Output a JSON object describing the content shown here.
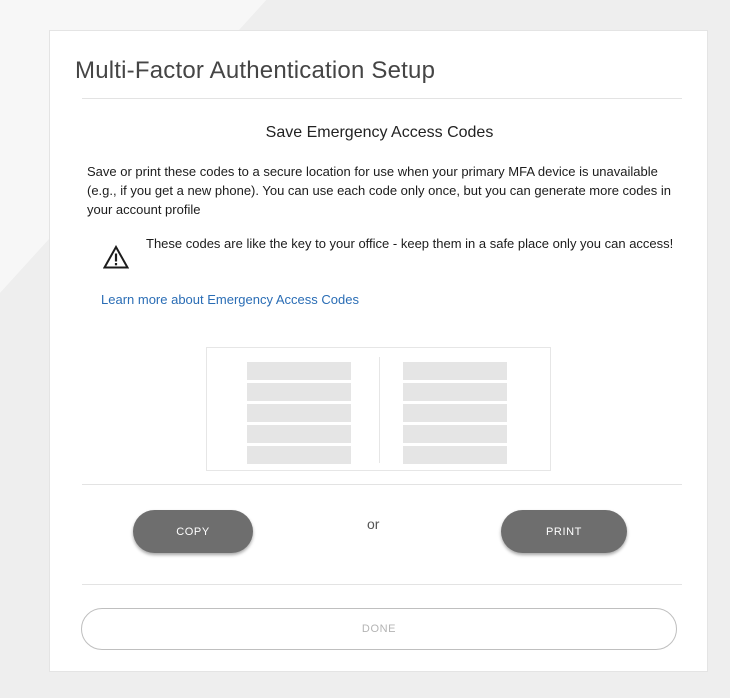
{
  "header": {
    "title": "Multi-Factor Authentication Setup"
  },
  "content": {
    "heading": "Save Emergency Access Codes",
    "description": "Save or print these codes to a secure location for use when your primary MFA device is unavailable (e.g., if you get a new phone). You can use each code only once, but you can generate more codes in your account profile",
    "warning": {
      "icon": "warning-triangle-icon",
      "text": "These codes are like the key to your office - keep them in a safe place only you can access!"
    },
    "learn_more_link": "Learn more about Emergency Access Codes"
  },
  "codes": {
    "left_column_rows": 5,
    "right_column_rows": 5
  },
  "actions": {
    "copy_label": "COPY",
    "separator": "or",
    "print_label": "PRINT",
    "done_label": "DONE"
  },
  "colors": {
    "button_primary": "#6e6e6e",
    "link": "#2a6db5",
    "done_text_disabled": "#b4b4b4"
  }
}
